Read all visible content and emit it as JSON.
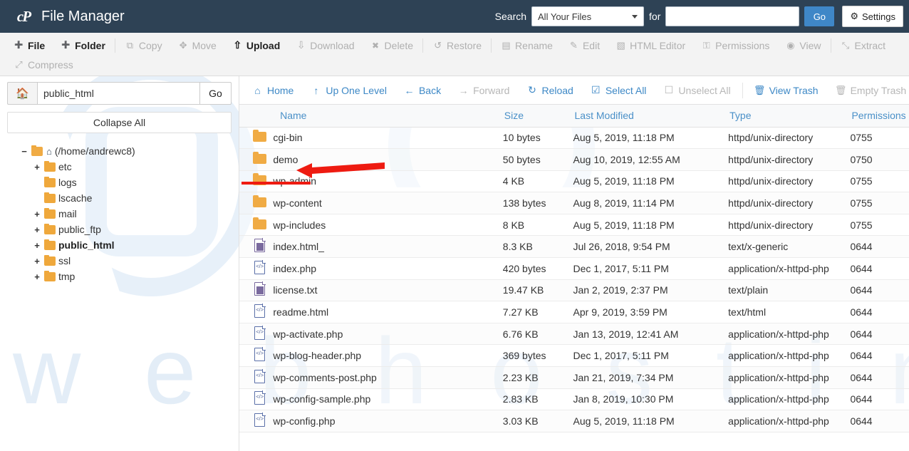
{
  "header": {
    "title": "File Manager",
    "logo": "cpanel-logo",
    "search_label": "Search",
    "search_scope": "All Your Files",
    "for_label": "for",
    "search_value": "",
    "search_placeholder": "",
    "go_label": "Go",
    "settings_label": "Settings",
    "bg_color": "#2e4255",
    "go_color": "#3f87c7"
  },
  "toolbar": {
    "row1": [
      {
        "label": "File",
        "icon": "plus-icon",
        "enabled": true
      },
      {
        "label": "Folder",
        "icon": "plus-icon",
        "enabled": true
      },
      {
        "label": "Copy",
        "icon": "copy-icon",
        "enabled": false
      },
      {
        "label": "Move",
        "icon": "move-icon",
        "enabled": false
      },
      {
        "label": "Upload",
        "icon": "upload-icon",
        "enabled": true
      },
      {
        "label": "Download",
        "icon": "download-icon",
        "enabled": false
      },
      {
        "label": "Delete",
        "icon": "delete-icon",
        "enabled": false
      },
      {
        "label": "Restore",
        "icon": "restore-icon",
        "enabled": false
      },
      {
        "label": "Rename",
        "icon": "rename-icon",
        "enabled": false
      },
      {
        "label": "Edit",
        "icon": "pencil-icon",
        "enabled": false
      },
      {
        "label": "HTML Editor",
        "icon": "html-editor-icon",
        "enabled": false
      },
      {
        "label": "Permissions",
        "icon": "key-icon",
        "enabled": false
      },
      {
        "label": "View",
        "icon": "eye-icon",
        "enabled": false
      },
      {
        "label": "Extract",
        "icon": "extract-icon",
        "enabled": false
      }
    ],
    "row2": [
      {
        "label": "Compress",
        "icon": "compress-icon",
        "enabled": false
      }
    ]
  },
  "sidebar": {
    "home_icon": "home-icon",
    "path_value": "public_html",
    "go_label": "Go",
    "collapse_label": "Collapse All",
    "tree": [
      {
        "label": "(/home/andrewc8)",
        "expander": "−",
        "depth": 0,
        "home": true,
        "bold": false,
        "open": true
      },
      {
        "label": "etc",
        "expander": "+",
        "depth": 1,
        "home": false,
        "bold": false,
        "open": false
      },
      {
        "label": "logs",
        "expander": "",
        "depth": 1,
        "home": false,
        "bold": false,
        "open": false
      },
      {
        "label": "lscache",
        "expander": "",
        "depth": 1,
        "home": false,
        "bold": false,
        "open": false
      },
      {
        "label": "mail",
        "expander": "+",
        "depth": 1,
        "home": false,
        "bold": false,
        "open": false
      },
      {
        "label": "public_ftp",
        "expander": "+",
        "depth": 1,
        "home": false,
        "bold": false,
        "open": false
      },
      {
        "label": "public_html",
        "expander": "+",
        "depth": 1,
        "home": false,
        "bold": true,
        "open": false
      },
      {
        "label": "ssl",
        "expander": "+",
        "depth": 1,
        "home": false,
        "bold": false,
        "open": false
      },
      {
        "label": "tmp",
        "expander": "+",
        "depth": 1,
        "home": false,
        "bold": false,
        "open": false
      }
    ]
  },
  "navbar": [
    {
      "label": "Home",
      "icon": "home-icon",
      "enabled": true
    },
    {
      "label": "Up One Level",
      "icon": "up-arrow-icon",
      "enabled": true
    },
    {
      "label": "Back",
      "icon": "arrow-left-icon",
      "enabled": true
    },
    {
      "label": "Forward",
      "icon": "arrow-right-icon",
      "enabled": false
    },
    {
      "label": "Reload",
      "icon": "reload-icon",
      "enabled": true
    },
    {
      "label": "Select All",
      "icon": "checkbox-checked-icon",
      "enabled": true
    },
    {
      "label": "Unselect All",
      "icon": "checkbox-empty-icon",
      "enabled": false
    },
    {
      "label": "View Trash",
      "icon": "trash-icon",
      "enabled": true
    },
    {
      "label": "Empty Trash",
      "icon": "trash-icon",
      "enabled": false
    }
  ],
  "table": {
    "columns": [
      "Name",
      "Size",
      "Last Modified",
      "Type",
      "Permissions"
    ],
    "rows": [
      {
        "name": "cgi-bin",
        "icon": "folder-icon",
        "size": "10 bytes",
        "modified": "Aug 5, 2019, 11:18 PM",
        "type": "httpd/unix-directory",
        "perms": "0755"
      },
      {
        "name": "demo",
        "icon": "folder-icon",
        "size": "50 bytes",
        "modified": "Aug 10, 2019, 12:55 AM",
        "type": "httpd/unix-directory",
        "perms": "0750"
      },
      {
        "name": "wp-admin",
        "icon": "folder-icon",
        "size": "4 KB",
        "modified": "Aug 5, 2019, 11:18 PM",
        "type": "httpd/unix-directory",
        "perms": "0755"
      },
      {
        "name": "wp-content",
        "icon": "folder-icon",
        "size": "138 bytes",
        "modified": "Aug 8, 2019, 11:14 PM",
        "type": "httpd/unix-directory",
        "perms": "0755"
      },
      {
        "name": "wp-includes",
        "icon": "folder-icon",
        "size": "8 KB",
        "modified": "Aug 5, 2019, 11:18 PM",
        "type": "httpd/unix-directory",
        "perms": "0755"
      },
      {
        "name": "index.html_",
        "icon": "text-file-icon",
        "size": "8.3 KB",
        "modified": "Jul 26, 2018, 9:54 PM",
        "type": "text/x-generic",
        "perms": "0644"
      },
      {
        "name": "index.php",
        "icon": "code-file-icon",
        "size": "420 bytes",
        "modified": "Dec 1, 2017, 5:11 PM",
        "type": "application/x-httpd-php",
        "perms": "0644"
      },
      {
        "name": "license.txt",
        "icon": "text-file-icon",
        "size": "19.47 KB",
        "modified": "Jan 2, 2019, 2:37 PM",
        "type": "text/plain",
        "perms": "0644"
      },
      {
        "name": "readme.html",
        "icon": "code-file-icon",
        "size": "7.27 KB",
        "modified": "Apr 9, 2019, 3:59 PM",
        "type": "text/html",
        "perms": "0644"
      },
      {
        "name": "wp-activate.php",
        "icon": "code-file-icon",
        "size": "6.76 KB",
        "modified": "Jan 13, 2019, 12:41 AM",
        "type": "application/x-httpd-php",
        "perms": "0644"
      },
      {
        "name": "wp-blog-header.php",
        "icon": "code-file-icon",
        "size": "369 bytes",
        "modified": "Dec 1, 2017, 5:11 PM",
        "type": "application/x-httpd-php",
        "perms": "0644"
      },
      {
        "name": "wp-comments-post.php",
        "icon": "code-file-icon",
        "size": "2.23 KB",
        "modified": "Jan 21, 2019, 7:34 PM",
        "type": "application/x-httpd-php",
        "perms": "0644"
      },
      {
        "name": "wp-config-sample.php",
        "icon": "code-file-icon",
        "size": "2.83 KB",
        "modified": "Jan 8, 2019, 10:30 PM",
        "type": "application/x-httpd-php",
        "perms": "0644"
      },
      {
        "name": "wp-config.php",
        "icon": "code-file-icon",
        "size": "3.03 KB",
        "modified": "Aug 5, 2019, 11:18 PM",
        "type": "application/x-httpd-php",
        "perms": "0644"
      }
    ]
  },
  "annotation": {
    "color": "#ee1b11",
    "target_row": "demo",
    "shape": "arrow-pointing-left-with-underline"
  },
  "watermark": {
    "text": "w e b   h o s t i n g",
    "color": "#e3edf7"
  }
}
